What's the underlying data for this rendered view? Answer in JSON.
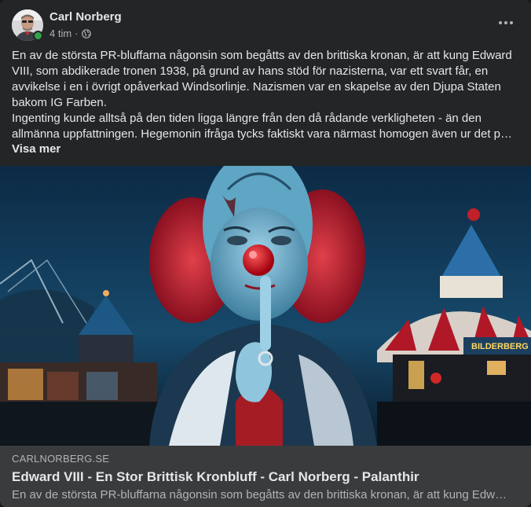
{
  "post": {
    "author": "Carl Norberg",
    "time": "4 tim",
    "separator": "·",
    "privacy_icon": "globe-icon",
    "body_lines": [
      "En av de största PR-bluffarna någonsin som begåtts av den brittiska kronan, är att kung Edward",
      "VIII, som abdikerade tronen 1938, på grund av hans stöd för nazisterna, var ett svart får, en",
      "avvikelse i en i övrigt opåverkad Windsorlinje. Nazismen var en skapelse av den Djupa Staten",
      "bakom IG Farben.",
      "Ingenting kunde alltså på den tiden ligga längre från den då rådande verkligheten - än den",
      "allmänna uppfattningen. Hegemonin ifråga tycks faktiskt vara närmast homogen även ur det p…"
    ],
    "see_more": "Visa mer",
    "more_icon": "more-options-icon"
  },
  "image": {
    "sign_text": "BILDERBERG"
  },
  "link": {
    "domain": "CARLNORBERG.SE",
    "title": "Edward VIII - En Stor Brittisk Kronbluff - Carl Norberg - Palanthir",
    "description": "En av de största PR-bluffarna någonsin som begåtts av den brittiska kronan, är att kung Edw…"
  },
  "colors": {
    "card_bg": "#242526",
    "link_bg": "#3a3b3c",
    "text_primary": "#e4e6eb",
    "text_secondary": "#b0b3b8",
    "online": "#31a24c"
  }
}
